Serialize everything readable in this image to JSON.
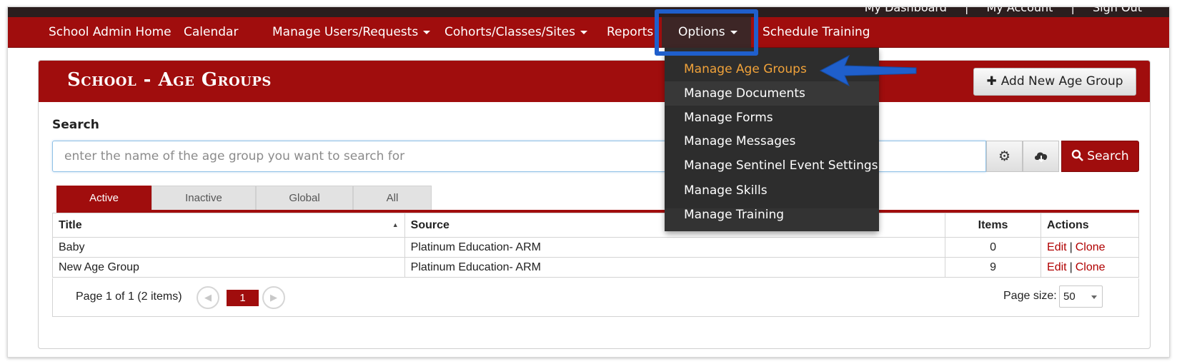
{
  "top_links": [
    "My Dashboard",
    "|",
    "My Account",
    "|",
    "Sign Out"
  ],
  "nav": {
    "items": [
      {
        "label": "School Admin Home",
        "has_caret": false
      },
      {
        "label": "Calendar",
        "has_caret": false
      },
      {
        "label": "Manage Users/Requests",
        "has_caret": true
      },
      {
        "label": "Cohorts/Classes/Sites",
        "has_caret": true
      },
      {
        "label": "Reports",
        "has_caret": false
      },
      {
        "label": "Options",
        "has_caret": true
      },
      {
        "label": "Schedule Training",
        "has_caret": false
      }
    ]
  },
  "options_menu": {
    "items": [
      {
        "label": "Manage Age Groups",
        "current": true
      },
      {
        "label": "Manage Documents"
      },
      {
        "label": "Manage Forms"
      },
      {
        "label": "Manage Messages"
      },
      {
        "label": "Manage Sentinel Event Settings"
      },
      {
        "label": "Manage Skills"
      },
      {
        "label": "Manage Training"
      }
    ]
  },
  "panel": {
    "title": "School - Age Groups",
    "add_button": "Add New Age Group"
  },
  "search": {
    "label": "Search",
    "placeholder": "enter the name of the age group you want to search for",
    "button": "Search",
    "icons": [
      "gear-icon",
      "cloud-download-icon",
      "search-icon"
    ]
  },
  "tabs": [
    {
      "label": "Active",
      "active": true
    },
    {
      "label": "Inactive",
      "active": false
    },
    {
      "label": "Global",
      "active": false
    },
    {
      "label": "All",
      "active": false
    }
  ],
  "table": {
    "headers": [
      "Title",
      "Source",
      "Items",
      "Actions"
    ],
    "rows": [
      {
        "title": "Baby",
        "source": "Platinum Education- ARM",
        "items": "0",
        "edit": "Edit",
        "sep": "|",
        "clone": "Clone"
      },
      {
        "title": "New Age Group",
        "source": "Platinum Education- ARM",
        "items": "9",
        "edit": "Edit",
        "sep": "|",
        "clone": "Clone"
      }
    ]
  },
  "pager": {
    "summary": "Page 1 of 1 (2 items)",
    "current_page": "1",
    "page_size_label": "Page size:",
    "page_size": "50"
  },
  "colors": {
    "brand_red": "#a00d0d",
    "menu_bg": "#2d2d2d",
    "menu_current": "#f0a23a",
    "highlight_blue": "#1f5fcc"
  }
}
